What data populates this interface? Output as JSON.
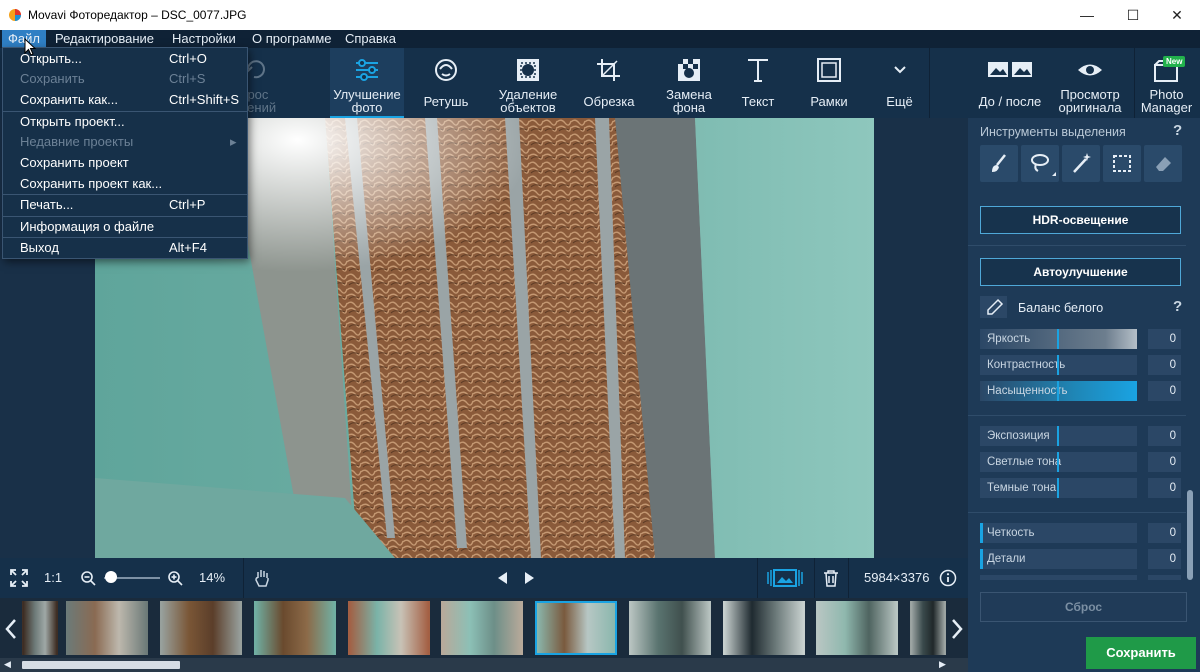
{
  "window": {
    "title": "Movavi Фоторедактор – DSC_0077.JPG",
    "minimize": "—",
    "maximize": "☐",
    "close": "✕"
  },
  "menu": {
    "items": [
      "Файл",
      "Редактирование",
      "Настройки",
      "О программе",
      "Справка"
    ]
  },
  "file_menu": [
    {
      "label": "Открыть...",
      "shortcut": "Ctrl+O",
      "enabled": true
    },
    {
      "label": "Сохранить",
      "shortcut": "Ctrl+S",
      "enabled": false
    },
    {
      "label": "Сохранить как...",
      "shortcut": "Ctrl+Shift+S",
      "enabled": true
    },
    {
      "label": "Открыть проект...",
      "shortcut": "",
      "enabled": true
    },
    {
      "label": "Недавние проекты",
      "shortcut": "▸",
      "enabled": false
    },
    {
      "label": "Сохранить проект",
      "shortcut": "",
      "enabled": true
    },
    {
      "label": "Сохранить проект как...",
      "shortcut": "",
      "enabled": true
    },
    {
      "label": "Печать...",
      "shortcut": "Ctrl+P",
      "enabled": true
    },
    {
      "label": "Информация о файле",
      "shortcut": "",
      "enabled": true
    },
    {
      "label": "Выход",
      "shortcut": "Alt+F4",
      "enabled": true
    }
  ],
  "toolbar": {
    "reset_partial_line1": "брос",
    "reset_partial_line2": "нений",
    "enhance_l1": "Улучшение",
    "enhance_l2": "фото",
    "retouch": "Ретушь",
    "remove_l1": "Удаление",
    "remove_l2": "объектов",
    "crop": "Обрезка",
    "bg_l1": "Замена",
    "bg_l2": "фона",
    "text": "Текст",
    "frames": "Рамки",
    "more": "Ещё",
    "before_after": "До / после",
    "view_l1": "Просмотр",
    "view_l2": "оригинала",
    "pm_badge": "New",
    "pm_l1": "Photo",
    "pm_l2": "Manager"
  },
  "bottombar": {
    "fit": "1:1",
    "zoom": "14%",
    "zoom_level": 0.05,
    "dimensions": "5984×3376"
  },
  "filmstrip": {
    "count": 10,
    "active_index": 5
  },
  "panel": {
    "selection_tools_label": "Инструменты выделения",
    "help": "?",
    "hdr_button": "HDR-освещение",
    "auto_button": "Автоулучшение",
    "white_balance": "Баланс белого",
    "sliders_a": [
      {
        "label": "Яркость",
        "value": "0"
      },
      {
        "label": "Контрастность",
        "value": "0"
      },
      {
        "label": "Насыщенность",
        "value": "0"
      }
    ],
    "sliders_b": [
      {
        "label": "Экспозиция",
        "value": "0"
      },
      {
        "label": "Светлые тона",
        "value": "0"
      },
      {
        "label": "Темные тона",
        "value": "0"
      }
    ],
    "sliders_c": [
      {
        "label": "Четкость",
        "value": "0"
      },
      {
        "label": "Детали",
        "value": "0"
      }
    ],
    "reset_button": "Сброс",
    "save_button": "Сохранить"
  },
  "colors": {
    "accent": "#1aa3e2",
    "save": "#1f9a48",
    "menu_active": "#2f7fc4"
  }
}
